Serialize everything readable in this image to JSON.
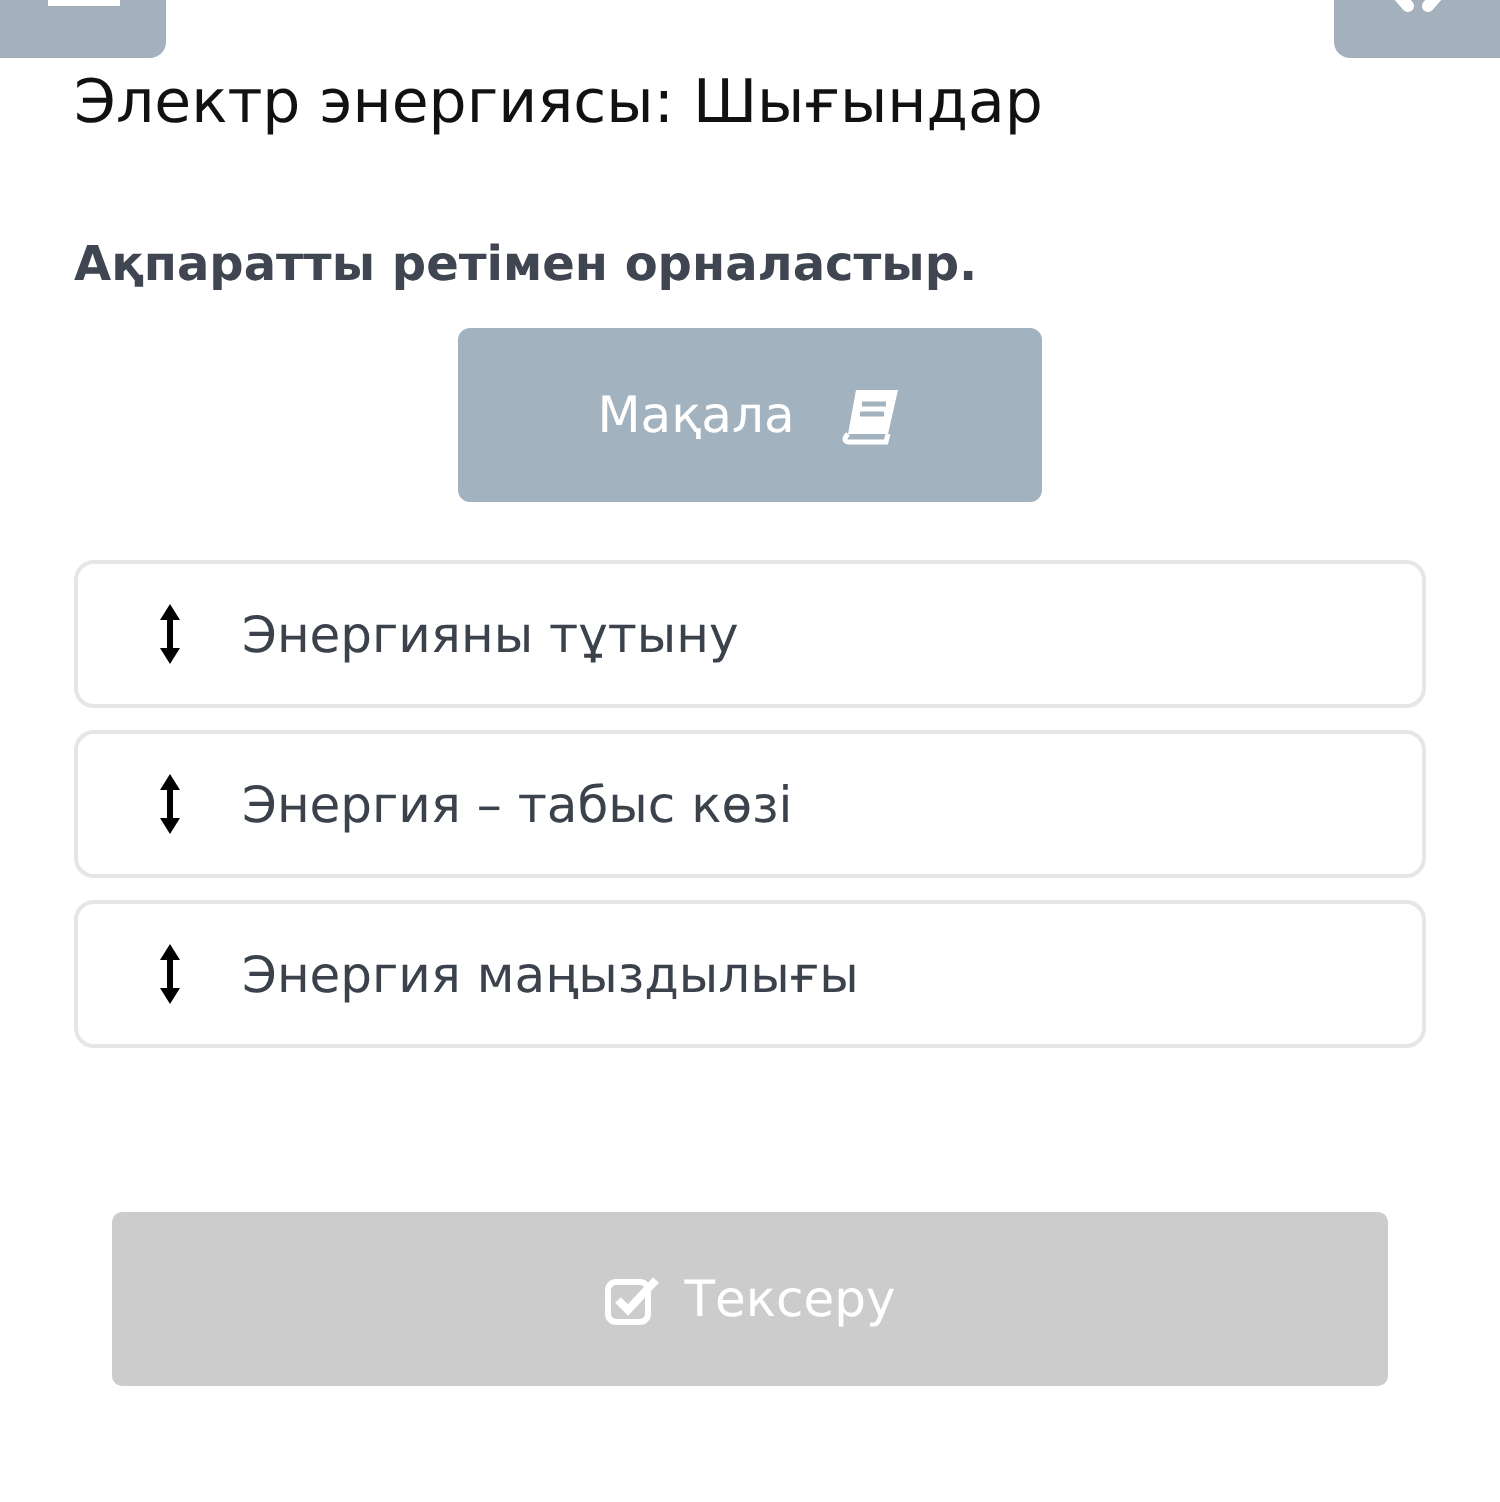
{
  "title": "Электр энергиясы: Шығындар",
  "instruction": "Ақпаратты ретімен орналастыр.",
  "article_button": {
    "label": "Мақала"
  },
  "items": [
    {
      "label": "Энергияны тұтыну"
    },
    {
      "label": "Энергия – табыс көзі"
    },
    {
      "label": "Энергия маңыздылығы"
    }
  ],
  "check_button": {
    "label": "Тексеру",
    "disabled": true
  }
}
